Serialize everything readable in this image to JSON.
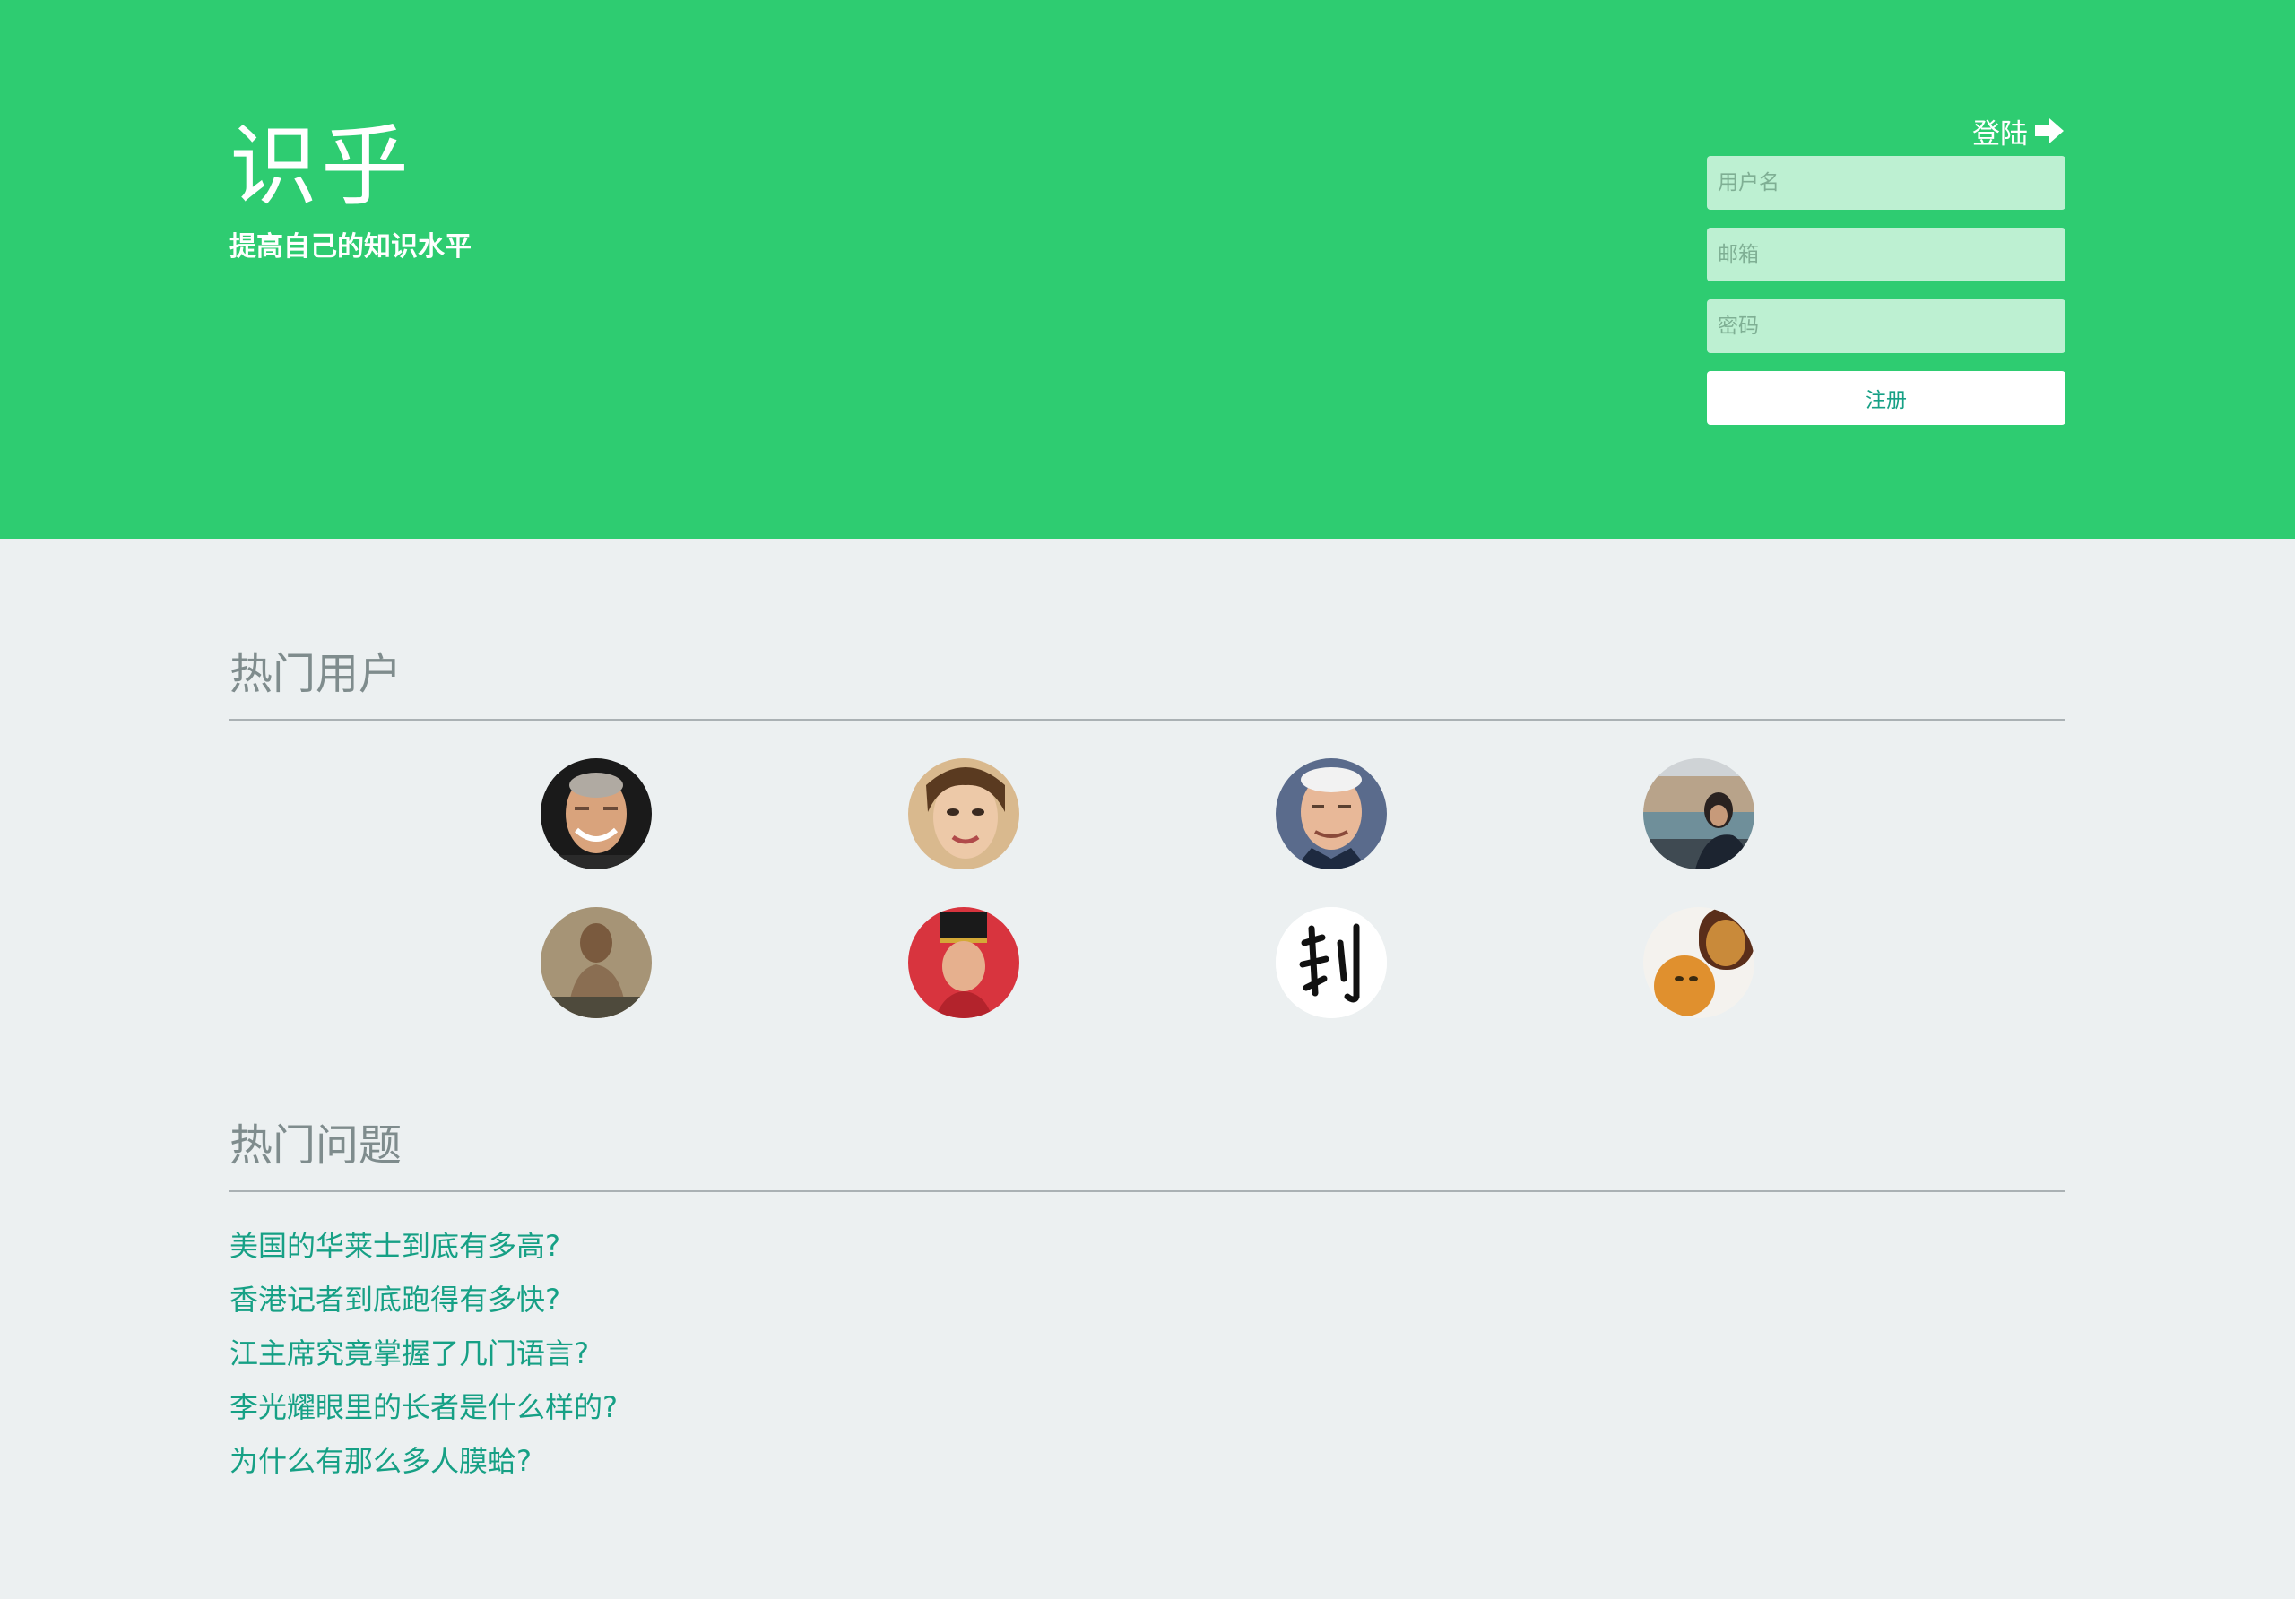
{
  "brand": {
    "title": "识乎",
    "subtitle": "提高自己的知识水平"
  },
  "auth": {
    "login_label": "登陆",
    "login_icon": "arrow-right-icon",
    "username_placeholder": "用户名",
    "email_placeholder": "邮箱",
    "password_placeholder": "密码",
    "register_label": "注册"
  },
  "hot_users": {
    "title": "热门用户",
    "users": [
      {
        "avatar": "avatar-elderly-man-smiling"
      },
      {
        "avatar": "avatar-woman-portrait"
      },
      {
        "avatar": "avatar-man-white-hair"
      },
      {
        "avatar": "avatar-woman-seaside"
      },
      {
        "avatar": "avatar-man-outdoor"
      },
      {
        "avatar": "avatar-person-red-hat"
      },
      {
        "avatar": "avatar-calligraphy-character"
      },
      {
        "avatar": "avatar-cat-and-lion"
      }
    ]
  },
  "hot_questions": {
    "title": "热门问题",
    "items": [
      "美国的华莱士到底有多高?",
      "香港记者到底跑得有多快?",
      "江主席究竟掌握了几门语言?",
      "李光耀眼里的长者是什么样的?",
      "为什么有那么多人膜蛤?"
    ]
  },
  "colors": {
    "hero_bg": "#2ecc71",
    "page_bg": "#ecf0f1",
    "input_bg": "#bdf0d2",
    "link": "#16a085",
    "heading": "#7f8c8d"
  }
}
